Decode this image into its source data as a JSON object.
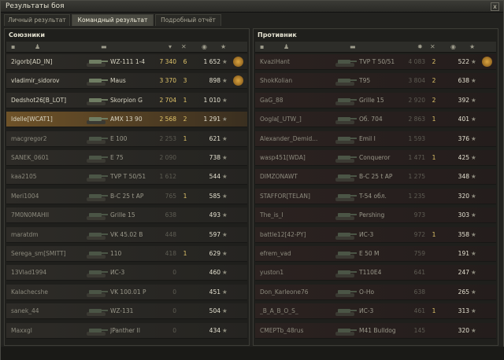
{
  "window": {
    "title": "Результаты боя",
    "close": "x"
  },
  "tabs": [
    "Личный результат",
    "Командный результат",
    "Подробный отчёт"
  ],
  "allies": {
    "title": "Союзники",
    "rows": [
      {
        "name": "2igorb[AD_IN]",
        "tank": "WZ-111 1-4",
        "dmg": "7 340",
        "frags": "6",
        "xp": "1 652",
        "medal": true,
        "dead": false
      },
      {
        "name": "vladimir_sidorov",
        "tank": "Maus",
        "dmg": "3 370",
        "frags": "3",
        "xp": "898",
        "medal": true,
        "dead": false
      },
      {
        "name": "Dedshot26[B_LOT]",
        "tank": "Skorpion G",
        "dmg": "2 704",
        "frags": "1",
        "xp": "1 010",
        "medal": false,
        "dead": false
      },
      {
        "name": "Idelle[WCAT1]",
        "tank": "AMX 13 90",
        "dmg": "2 568",
        "frags": "2",
        "xp": "1 291",
        "medal": false,
        "dead": false,
        "highlight": true
      },
      {
        "name": "macgregor2",
        "tank": "E 100",
        "dmg": "2 253",
        "frags": "1",
        "xp": "621",
        "medal": false,
        "dead": true
      },
      {
        "name": "SANEK_0601",
        "tank": "E 75",
        "dmg": "2 090",
        "frags": "",
        "xp": "738",
        "medal": false,
        "dead": true
      },
      {
        "name": "kaa2105",
        "tank": "TVP T 50/51",
        "dmg": "1 612",
        "frags": "",
        "xp": "544",
        "medal": false,
        "dead": true
      },
      {
        "name": "Meri1004",
        "tank": "B-C 25 t AP",
        "dmg": "765",
        "frags": "1",
        "xp": "585",
        "medal": false,
        "dead": true
      },
      {
        "name": "7M0N0MAHII",
        "tank": "Grille 15",
        "dmg": "638",
        "frags": "",
        "xp": "493",
        "medal": false,
        "dead": true
      },
      {
        "name": "maratdm",
        "tank": "VK 45.02 B",
        "dmg": "448",
        "frags": "",
        "xp": "597",
        "medal": false,
        "dead": true
      },
      {
        "name": "Serega_sm[SMITT]",
        "tank": "110",
        "dmg": "418",
        "frags": "1",
        "xp": "629",
        "medal": false,
        "dead": true
      },
      {
        "name": "13Vlad1994",
        "tank": "ИС-3",
        "dmg": "0",
        "frags": "",
        "xp": "460",
        "medal": false,
        "dead": true
      },
      {
        "name": "Kalachecshe",
        "tank": "VK 100.01 P",
        "dmg": "0",
        "frags": "",
        "xp": "451",
        "medal": false,
        "dead": true
      },
      {
        "name": "sanek_44",
        "tank": "WZ-131",
        "dmg": "0",
        "frags": "",
        "xp": "504",
        "medal": false,
        "dead": true
      },
      {
        "name": "Maxxgl",
        "tank": "JPanther II",
        "dmg": "0",
        "frags": "",
        "xp": "434",
        "medal": false,
        "dead": true
      }
    ]
  },
  "enemies": {
    "title": "Противник",
    "rows": [
      {
        "name": "KvaziHant",
        "tank": "TVP T 50/51",
        "dmg": "4 083",
        "frags": "2",
        "xp": "522",
        "medal": true,
        "dead": true
      },
      {
        "name": "ShokKolian",
        "tank": "T95",
        "dmg": "3 804",
        "frags": "2",
        "xp": "638",
        "medal": false,
        "dead": true
      },
      {
        "name": "GaG_88",
        "tank": "Grille 15",
        "dmg": "2 920",
        "frags": "2",
        "xp": "392",
        "medal": false,
        "dead": true
      },
      {
        "name": "Oogla[_UTW_]",
        "tank": "Об. 704",
        "dmg": "2 863",
        "frags": "1",
        "xp": "401",
        "medal": false,
        "dead": true
      },
      {
        "name": "Alexander_Demid...",
        "tank": "Emil I",
        "dmg": "1 593",
        "frags": "",
        "xp": "376",
        "medal": false,
        "dead": true
      },
      {
        "name": "wasp451[WDA]",
        "tank": "Conqueror",
        "dmg": "1 471",
        "frags": "1",
        "xp": "425",
        "medal": false,
        "dead": true
      },
      {
        "name": "DIMZONAWT",
        "tank": "B-C 25 t AP",
        "dmg": "1 275",
        "frags": "",
        "xp": "348",
        "medal": false,
        "dead": true
      },
      {
        "name": "STAFFOR[TELAN]",
        "tank": "T-54 обл.",
        "dmg": "1 235",
        "frags": "",
        "xp": "320",
        "medal": false,
        "dead": true
      },
      {
        "name": "The_is_I",
        "tank": "Pershing",
        "dmg": "973",
        "frags": "",
        "xp": "303",
        "medal": false,
        "dead": true
      },
      {
        "name": "battle12[42-PY]",
        "tank": "ИС-3",
        "dmg": "972",
        "frags": "1",
        "xp": "358",
        "medal": false,
        "dead": true
      },
      {
        "name": "efrem_vad",
        "tank": "E 50 M",
        "dmg": "759",
        "frags": "",
        "xp": "191",
        "medal": false,
        "dead": true
      },
      {
        "name": "yuston1",
        "tank": "T110E4",
        "dmg": "641",
        "frags": "",
        "xp": "247",
        "medal": false,
        "dead": true
      },
      {
        "name": "Don_Karleone76",
        "tank": "O-Ho",
        "dmg": "638",
        "frags": "",
        "xp": "265",
        "medal": false,
        "dead": true
      },
      {
        "name": "_B_A_B_O_S_",
        "tank": "ИС-3",
        "dmg": "461",
        "frags": "1",
        "xp": "313",
        "medal": false,
        "dead": true
      },
      {
        "name": "CMEPTb_48rus",
        "tank": "M41 Bulldog",
        "dmg": "145",
        "frags": "",
        "xp": "320",
        "medal": false,
        "dead": true
      }
    ]
  },
  "star_glyph": "★"
}
